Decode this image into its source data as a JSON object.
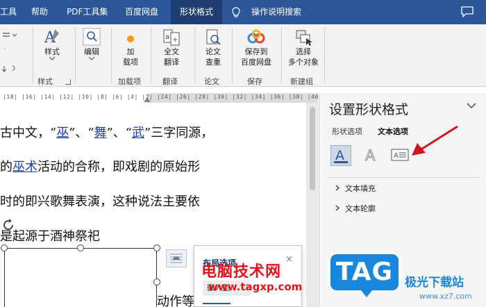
{
  "tabs": [
    {
      "label": "工具",
      "active": false
    },
    {
      "label": "帮助",
      "active": false
    },
    {
      "label": "PDF工具集",
      "active": false
    },
    {
      "label": "百度网盘",
      "active": false
    },
    {
      "label": "形状格式",
      "active": true
    }
  ],
  "search_label": "操作说明搜索",
  "ribbon": {
    "style_label": "样式",
    "edit_label": "编辑",
    "addin_label1": "加",
    "addin_label2": "载项",
    "translate_label1": "全文",
    "translate_label2": "翻译",
    "check_label1": "论文",
    "check_label2": "查重",
    "save_label1": "保存到",
    "save_label2": "百度网盘",
    "select_label1": "选择",
    "select_label2": "多个对象",
    "groups": {
      "style": "样式",
      "addin": "加载项",
      "translate": "翻译",
      "paper": "论文",
      "save": "保存",
      "new": "新建组"
    }
  },
  "ruler_text": "|18| |16| |14| |12| |10| |8| |6| |4| |2| |24| |26| |28| |30| |32| |34| |36| |38| |40|",
  "document": {
    "line1": {
      "pre": "古中文，“",
      "w1": "巫",
      "m1": "”、“",
      "w2": "舞",
      "m2": "”、“",
      "w3": "武",
      "post": "”三字同源，"
    },
    "line2": {
      "pre": "的",
      "link": "巫术",
      "post": "活动的合称，即戏剧的原始形"
    },
    "line3": "时的即兴歌舞表演，这种说法主要依",
    "line4": "是起源于酒神祭祀",
    "tail": "动作等"
  },
  "layout_popup": {
    "title": "布局选项",
    "close": "×",
    "inline_label": "嵌入型"
  },
  "pane": {
    "title": "设置形状格式",
    "tab_shape": "形状选项",
    "tab_text": "文本选项",
    "section_fill": "文本填充",
    "section_outline": "文本轮廓"
  },
  "watermark": {
    "site_title": "电脑技术网",
    "site_url": "www.tagxp.com",
    "tag": "TAG",
    "cn_name": "极光下载站",
    "url2": "www.xz7.com"
  },
  "colors": {
    "tab_bar": "#2b579a",
    "active_tab": "#1f3f73",
    "link": "#1a3fb0",
    "annotation_arrow": "#d0161c",
    "watermark_red": "#e8111a",
    "watermark_blue": "#1a87df"
  }
}
